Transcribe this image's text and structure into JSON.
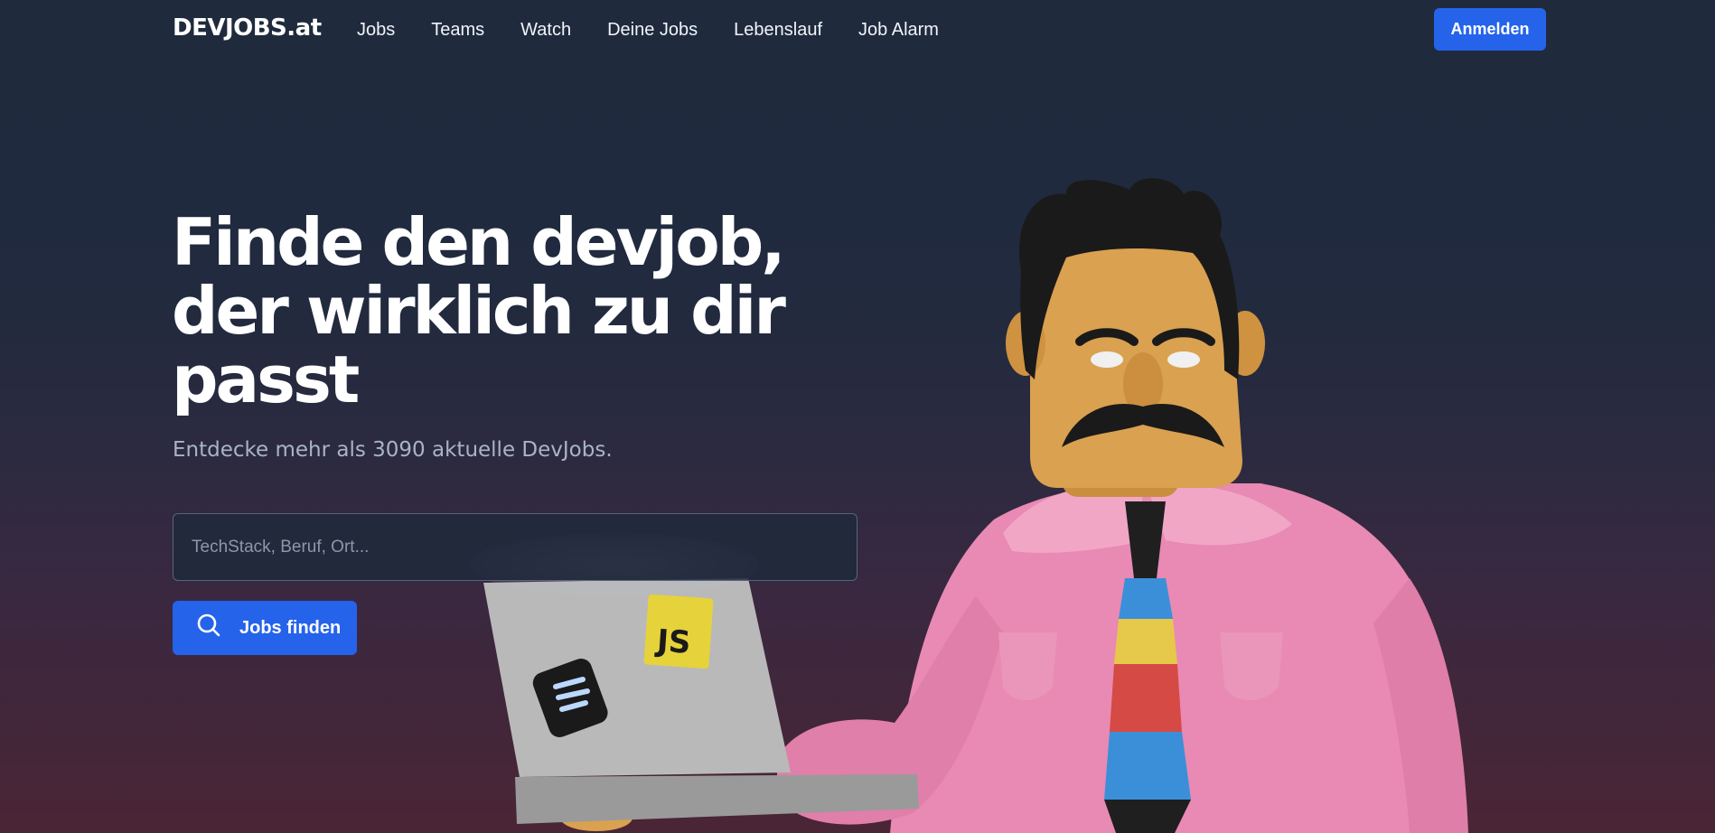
{
  "nav": {
    "logo": "DEVJOBS.at",
    "links": [
      "Jobs",
      "Teams",
      "Watch",
      "Deine Jobs",
      "Lebenslauf",
      "Job Alarm"
    ],
    "login_label": "Anmelden"
  },
  "hero": {
    "title_line1": "Finde den devjob,",
    "title_line2": "der wirklich zu dir",
    "title_line3": "passt",
    "subtitle": "Entdecke mehr als 3090 aktuelle DevJobs."
  },
  "search": {
    "placeholder": "TechStack, Beruf, Ort...",
    "value": "",
    "button_label": "Jobs finden",
    "button_icon": "search-icon"
  },
  "illustration": {
    "laptop_sticker_js": "JS",
    "colors": {
      "shirt": "#e88ab3",
      "skin": "#d9a150",
      "hair": "#1a1a1a",
      "laptop": "#b9b9b9",
      "tie_blue": "#3b8fd9",
      "tie_yellow": "#e6c84a",
      "tie_red": "#d64a45",
      "accent": "#2563eb"
    }
  }
}
